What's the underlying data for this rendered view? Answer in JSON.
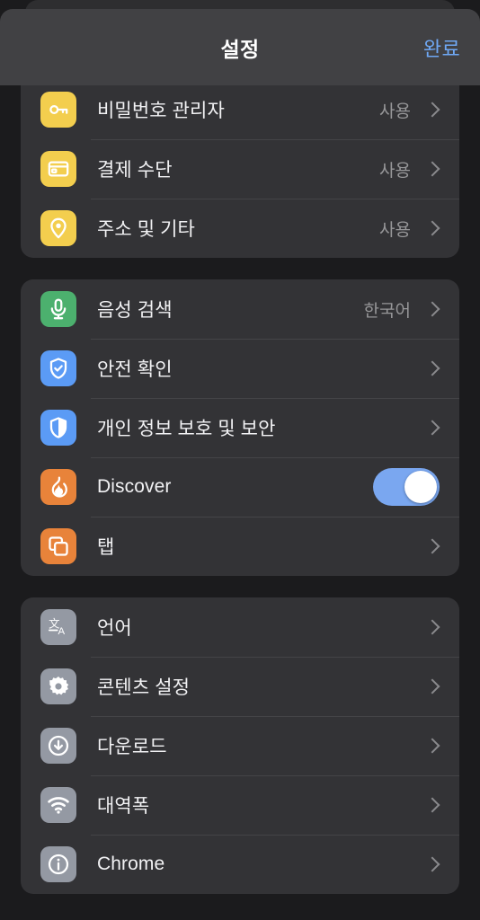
{
  "header": {
    "title": "설정",
    "done_label": "완료"
  },
  "colors": {
    "page_background": "#1b1b1d",
    "card_background": "#333336",
    "header_background": "#414144",
    "accent_blue": "#6fa8f5",
    "toggle_on": "#7aa7f0",
    "icon_yellow": "#f3ce4e",
    "icon_green": "#4cb06e",
    "icon_blue": "#5b9bf5",
    "icon_orange": "#e8833a",
    "icon_gray": "#9499a3",
    "value_text": "#979799",
    "label_text": "#f2f2f4"
  },
  "groups": [
    {
      "id": "autofill",
      "rows": [
        {
          "label": "비밀번호 관리자",
          "value": "사용",
          "icon": "key-icon",
          "icon_color": "#f3ce4e",
          "accessory": "chevron"
        },
        {
          "label": "결제 수단",
          "value": "사용",
          "icon": "credit-card-icon",
          "icon_color": "#f3ce4e",
          "accessory": "chevron"
        },
        {
          "label": "주소 및 기타",
          "value": "사용",
          "icon": "location-pin-icon",
          "icon_color": "#f3ce4e",
          "accessory": "chevron"
        }
      ]
    },
    {
      "id": "basics",
      "rows": [
        {
          "label": "음성 검색",
          "value": "한국어",
          "icon": "microphone-icon",
          "icon_color": "#4cb06e",
          "accessory": "chevron"
        },
        {
          "label": "안전 확인",
          "value": "",
          "icon": "shield-check-icon",
          "icon_color": "#5b9bf5",
          "accessory": "chevron"
        },
        {
          "label": "개인 정보 보호 및 보안",
          "value": "",
          "icon": "shield-privacy-icon",
          "icon_color": "#5b9bf5",
          "accessory": "chevron"
        },
        {
          "label": "Discover",
          "value": "",
          "icon": "flame-icon",
          "icon_color": "#e8833a",
          "accessory": "toggle",
          "toggle_on": true
        },
        {
          "label": "탭",
          "value": "",
          "icon": "tabs-icon",
          "icon_color": "#e8833a",
          "accessory": "chevron"
        }
      ]
    },
    {
      "id": "advanced",
      "rows": [
        {
          "label": "언어",
          "value": "",
          "icon": "translate-icon",
          "icon_color": "#9499a3",
          "accessory": "chevron"
        },
        {
          "label": "콘텐츠 설정",
          "value": "",
          "icon": "gear-icon",
          "icon_color": "#9499a3",
          "accessory": "chevron"
        },
        {
          "label": "다운로드",
          "value": "",
          "icon": "download-icon",
          "icon_color": "#9499a3",
          "accessory": "chevron"
        },
        {
          "label": "대역폭",
          "value": "",
          "icon": "wifi-icon",
          "icon_color": "#9499a3",
          "accessory": "chevron"
        },
        {
          "label": "Chrome",
          "value": "",
          "icon": "info-icon",
          "icon_color": "#9499a3",
          "accessory": "chevron"
        }
      ]
    }
  ]
}
